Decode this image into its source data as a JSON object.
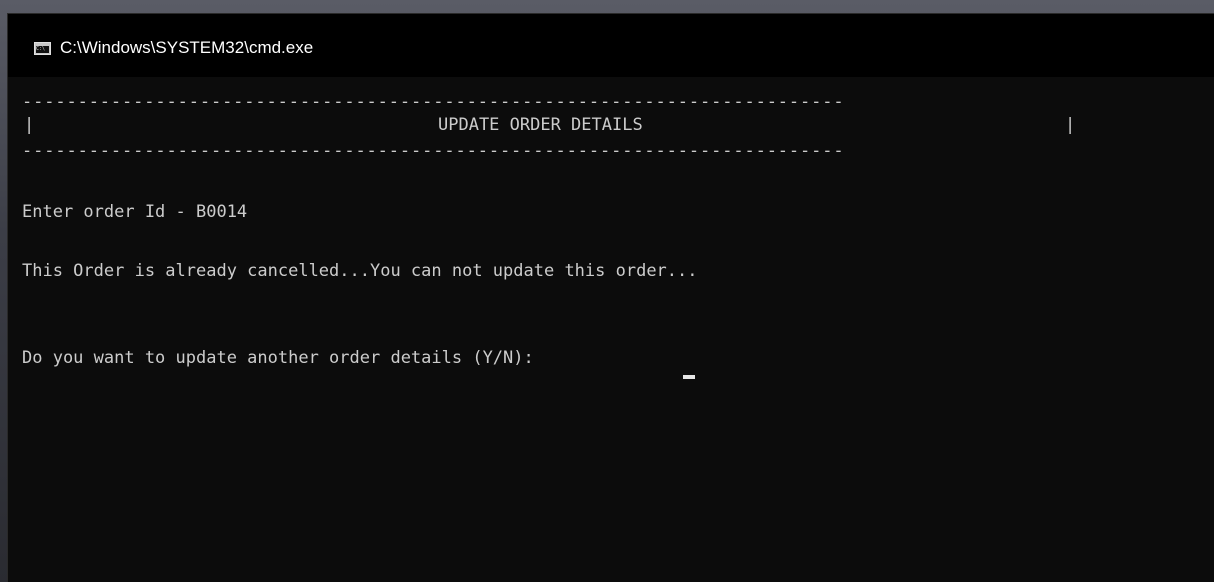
{
  "window": {
    "title": "C:\\Windows\\SYSTEM32\\cmd.exe",
    "icon": "cmd-icon",
    "icon_text": "C:\\"
  },
  "console": {
    "dash_line": "--------------------------------------------------------------------------",
    "bar": "|",
    "header": "UPDATE ORDER DETAILS",
    "enter_prompt": "Enter order Id - B0014",
    "status_message": "This Order is already cancelled...You can not update this order...",
    "continue_prompt": "Do you want to update another order details (Y/N): "
  },
  "colors": {
    "background": "#0c0c0c",
    "text": "#cccccc",
    "titlebar": "#000000"
  }
}
